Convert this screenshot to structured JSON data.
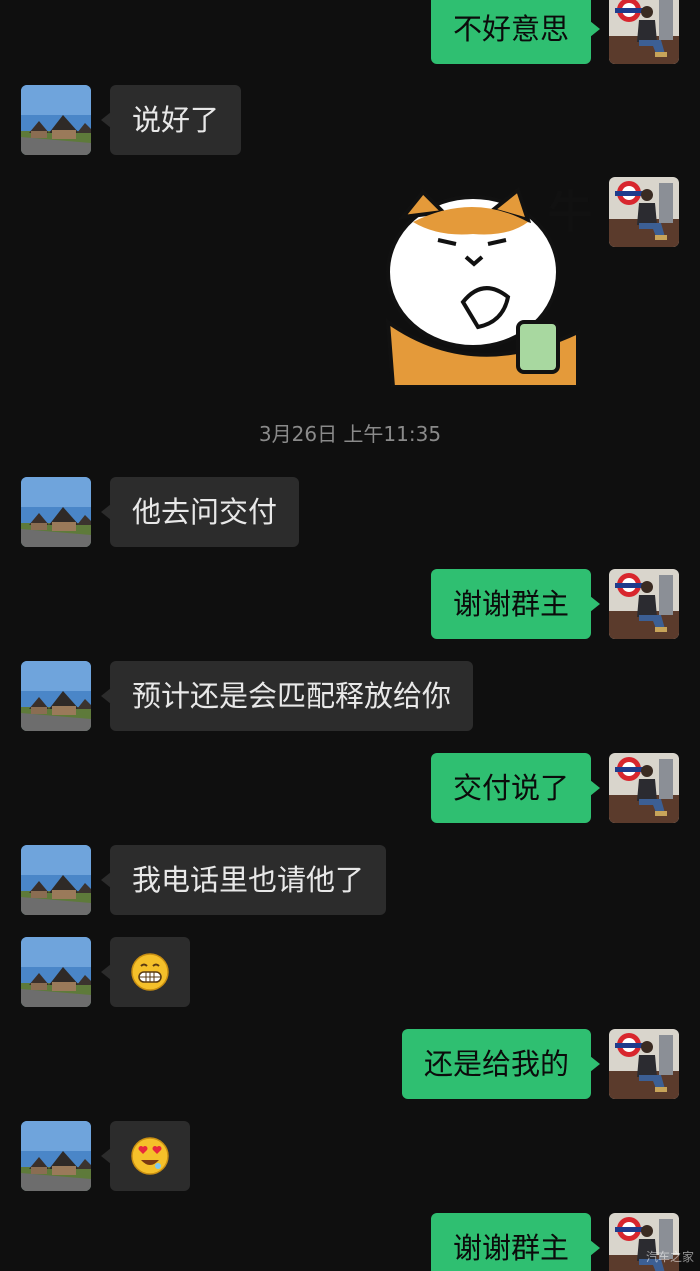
{
  "timestamp": "3月26日 上午11:35",
  "sticker": {
    "text": "牛"
  },
  "watermark": "汽车之家",
  "messages": [
    {
      "side": "out",
      "text": "不好意思"
    },
    {
      "side": "in",
      "text": "说好了"
    },
    {
      "side": "out",
      "type": "sticker"
    },
    {
      "side": "in",
      "text": "他去问交付"
    },
    {
      "side": "out",
      "text": "谢谢群主"
    },
    {
      "side": "in",
      "text": "预计还是会匹配释放给你"
    },
    {
      "side": "out",
      "text": "交付说了"
    },
    {
      "side": "in",
      "text": "我电话里也请他了"
    },
    {
      "side": "in",
      "type": "emoji",
      "emoji": "grinning-face"
    },
    {
      "side": "out",
      "text": "还是给我的"
    },
    {
      "side": "in",
      "type": "emoji",
      "emoji": "heart-eyes-face"
    },
    {
      "side": "out",
      "text": "谢谢群主"
    }
  ],
  "colors": {
    "background": "#0f0f0f",
    "incoming_bubble": "#2c2c2c",
    "outgoing_bubble": "#2fbf71"
  }
}
